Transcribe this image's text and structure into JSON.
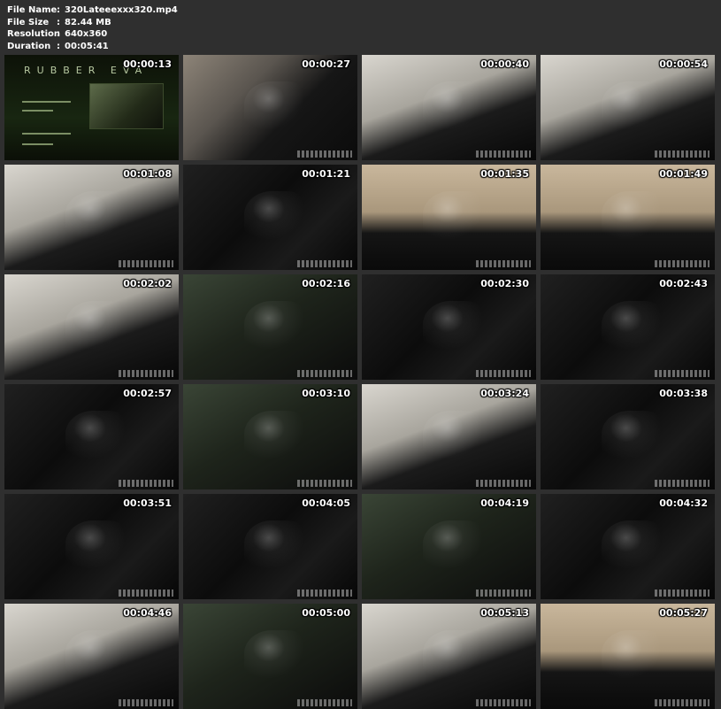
{
  "file_info": [
    {
      "label": "File Name",
      "value": "320Lateeexxx320.mp4"
    },
    {
      "label": "File Size",
      "value": "82.44 MB"
    },
    {
      "label": "Resolution",
      "value": "640x360"
    },
    {
      "label": "Duration",
      "value": "00:05:41"
    }
  ],
  "separator": ":",
  "thumbnails": [
    {
      "time": "00:00:13",
      "style": "logo"
    },
    {
      "time": "00:00:27",
      "style": "light"
    },
    {
      "time": "00:00:40",
      "style": "bath"
    },
    {
      "time": "00:00:54",
      "style": "bath"
    },
    {
      "time": "00:01:08",
      "style": "bath"
    },
    {
      "time": "00:01:21",
      "style": "dark"
    },
    {
      "time": "00:01:35",
      "style": "tile"
    },
    {
      "time": "00:01:49",
      "style": "tile"
    },
    {
      "time": "00:02:02",
      "style": "bath"
    },
    {
      "time": "00:02:16",
      "style": "green"
    },
    {
      "time": "00:02:30",
      "style": "dark"
    },
    {
      "time": "00:02:43",
      "style": "dark"
    },
    {
      "time": "00:02:57",
      "style": "dark"
    },
    {
      "time": "00:03:10",
      "style": "green"
    },
    {
      "time": "00:03:24",
      "style": "bath"
    },
    {
      "time": "00:03:38",
      "style": "dark"
    },
    {
      "time": "00:03:51",
      "style": "dark"
    },
    {
      "time": "00:04:05",
      "style": "dark"
    },
    {
      "time": "00:04:19",
      "style": "green"
    },
    {
      "time": "00:04:32",
      "style": "dark"
    },
    {
      "time": "00:04:46",
      "style": "bath"
    },
    {
      "time": "00:05:00",
      "style": "green"
    },
    {
      "time": "00:05:13",
      "style": "bath"
    },
    {
      "time": "00:05:27",
      "style": "tile"
    }
  ],
  "logo_text": "RUBBER EVA"
}
